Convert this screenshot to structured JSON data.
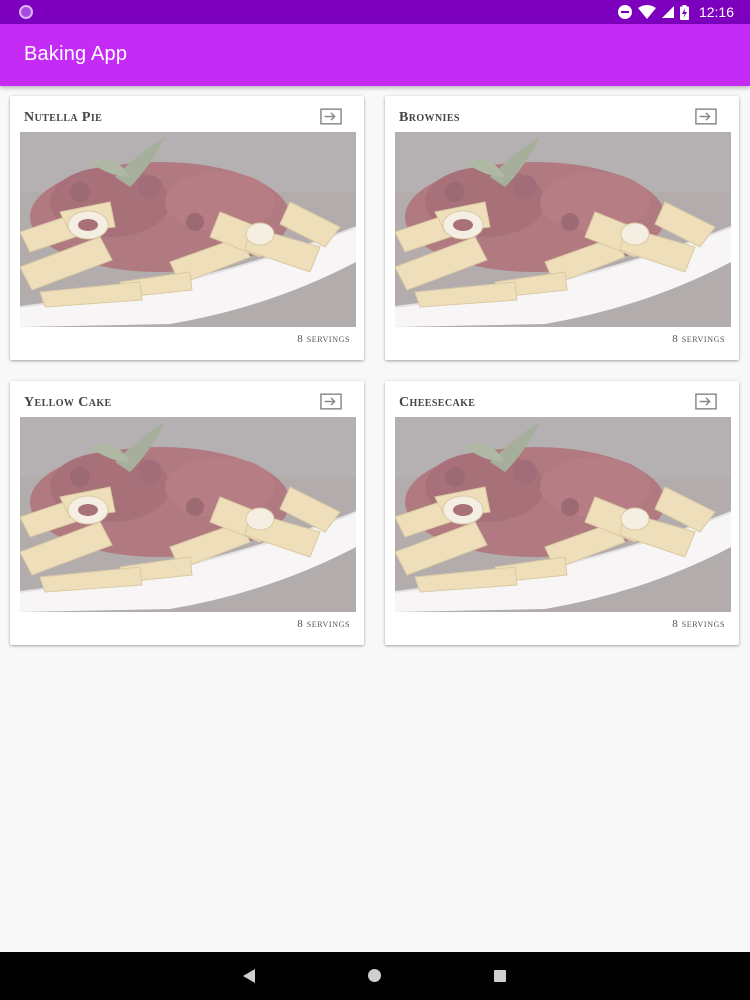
{
  "status_bar": {
    "time": "12:16",
    "icons": [
      "notification-dot-icon",
      "do-not-disturb-icon",
      "wifi-icon",
      "cell-signal-icon",
      "battery-charging-icon"
    ]
  },
  "app_bar": {
    "title": "Baking App"
  },
  "recipes": [
    {
      "name": "Nutella Pie",
      "servings": "8 servings",
      "image_icon": "recipe-image"
    },
    {
      "name": "Brownies",
      "servings": "8 servings",
      "image_icon": "recipe-image"
    },
    {
      "name": "Yellow Cake",
      "servings": "8 servings",
      "image_icon": "recipe-image"
    },
    {
      "name": "Cheesecake",
      "servings": "8 servings",
      "image_icon": "recipe-image"
    }
  ],
  "card_action_icon": "open-in-widget-icon",
  "nav_bar": {
    "icons": [
      "back-icon",
      "home-icon",
      "recents-icon"
    ]
  },
  "colors": {
    "status_bar": "#7c00bd",
    "app_bar": "#c42cf6",
    "background": "#f8f8f8"
  }
}
